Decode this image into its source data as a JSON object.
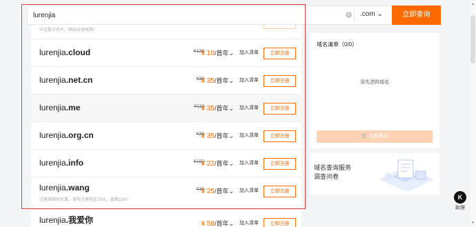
{
  "search": {
    "value": "lurenjia",
    "tld": ".com",
    "button": "立即查询"
  },
  "list": {
    "top_fragment_note": "中文数字名片，网站全球抢购！",
    "rows": [
      {
        "name": "lurenjia",
        "tld": ".cloud",
        "original": "¥129",
        "price": "¥ 10",
        "unit": "/首年",
        "add_to_cart": "加入清单",
        "register": "立即注册",
        "note": ""
      },
      {
        "name": "lurenjia",
        "tld": ".net.cn",
        "original": "¥39",
        "price": "¥ 35",
        "unit": "/首年",
        "add_to_cart": "加入清单",
        "register": "立即注册",
        "note": ""
      },
      {
        "name": "lurenjia",
        "tld": ".me",
        "original": "¥116",
        "price": "¥ 35",
        "unit": "/首年",
        "add_to_cart": "加入清单",
        "register": "立即注册",
        "note": ""
      },
      {
        "name": "lurenjia",
        "tld": ".org.cn",
        "original": "¥39",
        "price": "¥ 35",
        "unit": "/首年",
        "add_to_cart": "加入清单",
        "register": "立即注册",
        "note": ""
      },
      {
        "name": "lurenjia",
        "tld": ".info",
        "original": "¥160",
        "price": "¥ 22",
        "unit": "/首年",
        "add_to_cart": "加入清单",
        "register": "立即注册",
        "note": ""
      },
      {
        "name": "lurenjia",
        "tld": ".wang",
        "original": "¥39",
        "price": "¥ 25",
        "unit": "/首年",
        "add_to_cart": "加入清单",
        "register": "立即注册",
        "note": "注册局限时优惠，首年注册低至25元，直降22%！"
      },
      {
        "name": "lurenjia",
        "tld": ".我爱你",
        "original": "",
        "price": "¥ 58",
        "unit": "/首年",
        "add_to_cart": "加入清单",
        "register": "立即注册",
        "note": ""
      }
    ]
  },
  "cart": {
    "title": "域名清单（0/0）",
    "empty": "请先选购域名",
    "buy": "立即购买"
  },
  "survey": {
    "line1": "域名查询服务",
    "line2": "调查问卷"
  },
  "help": {
    "label": "助理"
  },
  "colors": {
    "accent": "#ff6a00",
    "highlight": "#e23a3a"
  }
}
